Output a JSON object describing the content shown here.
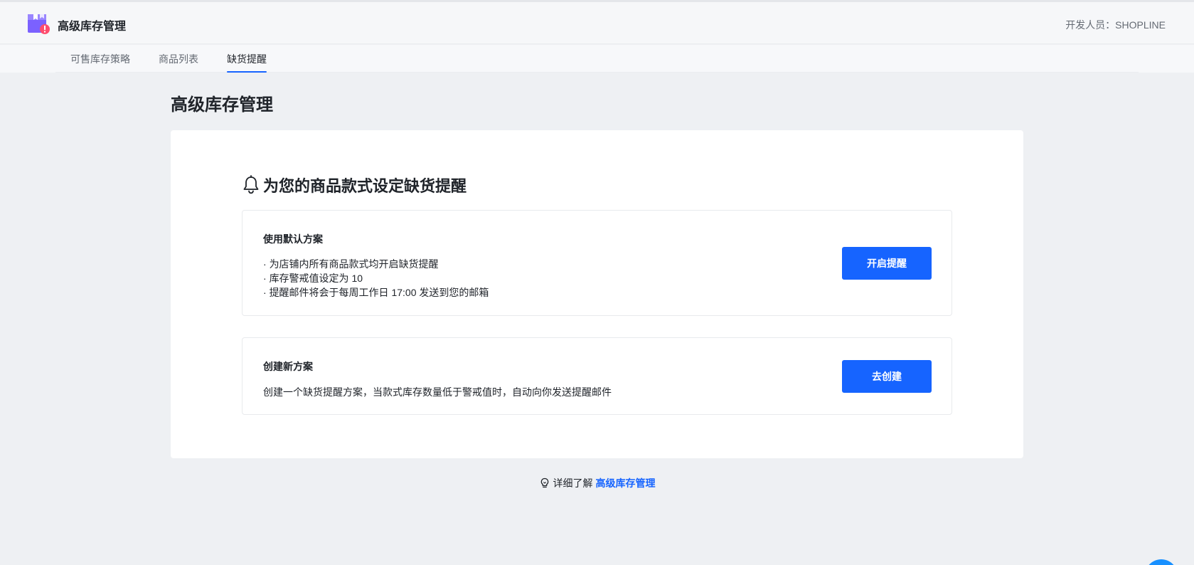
{
  "header": {
    "app_title": "高级库存管理",
    "developer": "开发人员：SHOPLINE",
    "logo_icon": "inventory-box-alert-icon"
  },
  "tabs": [
    {
      "label": "可售库存策略",
      "active": false
    },
    {
      "label": "商品列表",
      "active": false
    },
    {
      "label": "缺货提醒",
      "active": true
    }
  ],
  "main": {
    "page_title": "高级库存管理",
    "card": {
      "heading": "为您的商品款式设定缺货提醒",
      "heading_icon": "bell-icon",
      "default_plan": {
        "title": "使用默认方案",
        "bullets": [
          "为店铺内所有商品款式均开启缺货提醒",
          "库存警戒值设定为 10",
          "提醒邮件将会于每周工作日 17:00 发送到您的邮箱"
        ],
        "button_label": "开启提醒"
      },
      "new_plan": {
        "title": "创建新方案",
        "description": "创建一个缺货提醒方案，当款式库存数量低于警戒值时，自动向你发送提醒邮件",
        "button_label": "去创建"
      }
    },
    "footer": {
      "prefix": "详细了解",
      "link_label": "高级库存管理",
      "icon": "lightbulb-icon"
    }
  },
  "colors": {
    "primary": "#1664ff",
    "background": "#eef0f3",
    "logo_purple": "#7b61ff",
    "logo_badge": "#ff4d6d"
  }
}
